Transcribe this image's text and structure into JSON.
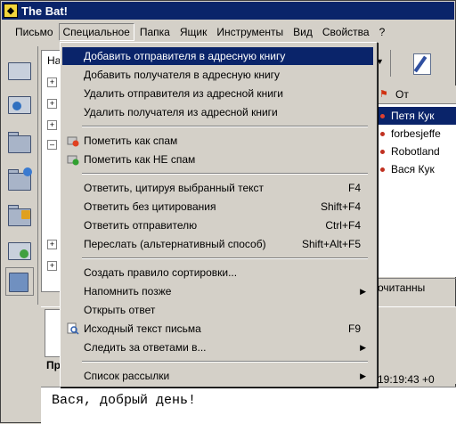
{
  "window": {
    "title": "The Bat!"
  },
  "menu_bar": {
    "items": [
      {
        "label": "Письмо"
      },
      {
        "label": "Специальное"
      },
      {
        "label": "Папка"
      },
      {
        "label": "Ящик"
      },
      {
        "label": "Инструменты"
      },
      {
        "label": "Вид"
      },
      {
        "label": "Свойства"
      },
      {
        "label": "?"
      }
    ]
  },
  "special_menu": {
    "items": [
      {
        "label": "Добавить отправителя в адресную книгу"
      },
      {
        "label": "Добавить получателя в адресную книгу"
      },
      {
        "label": "Удалить отправителя из адресной книги"
      },
      {
        "label": "Удалить получателя из адресной книги"
      },
      {
        "label": "Пометить как спам"
      },
      {
        "label": "Пометить как НЕ спам"
      },
      {
        "label": "Ответить, цитируя выбранный текст",
        "shortcut": "F4"
      },
      {
        "label": "Ответить без цитирования",
        "shortcut": "Shift+F4"
      },
      {
        "label": "Ответить отправителю",
        "shortcut": "Ctrl+F4"
      },
      {
        "label": "Переслать (альтернативный способ)",
        "shortcut": "Shift+Alt+F5"
      },
      {
        "label": "Создать правило сортировки..."
      },
      {
        "label": "Напомнить позже"
      },
      {
        "label": "Открыть ответ"
      },
      {
        "label": "Исходный текст письма",
        "shortcut": "F9"
      },
      {
        "label": "Следить за ответами в..."
      },
      {
        "label": "Список рассылки"
      }
    ]
  },
  "folder_tree": {
    "header": "На"
  },
  "message_list": {
    "column_from": "От",
    "rows": [
      {
        "from": "Петя Кук"
      },
      {
        "from": "forbesjeffe"
      },
      {
        "from": "Robotland"
      },
      {
        "from": "Вася Кук"
      }
    ],
    "tab_label": "очитанны"
  },
  "preview": {
    "label_fragment": "Пр",
    "time": "19:19:43 +0",
    "body_text": "Вася, добрый день!"
  }
}
